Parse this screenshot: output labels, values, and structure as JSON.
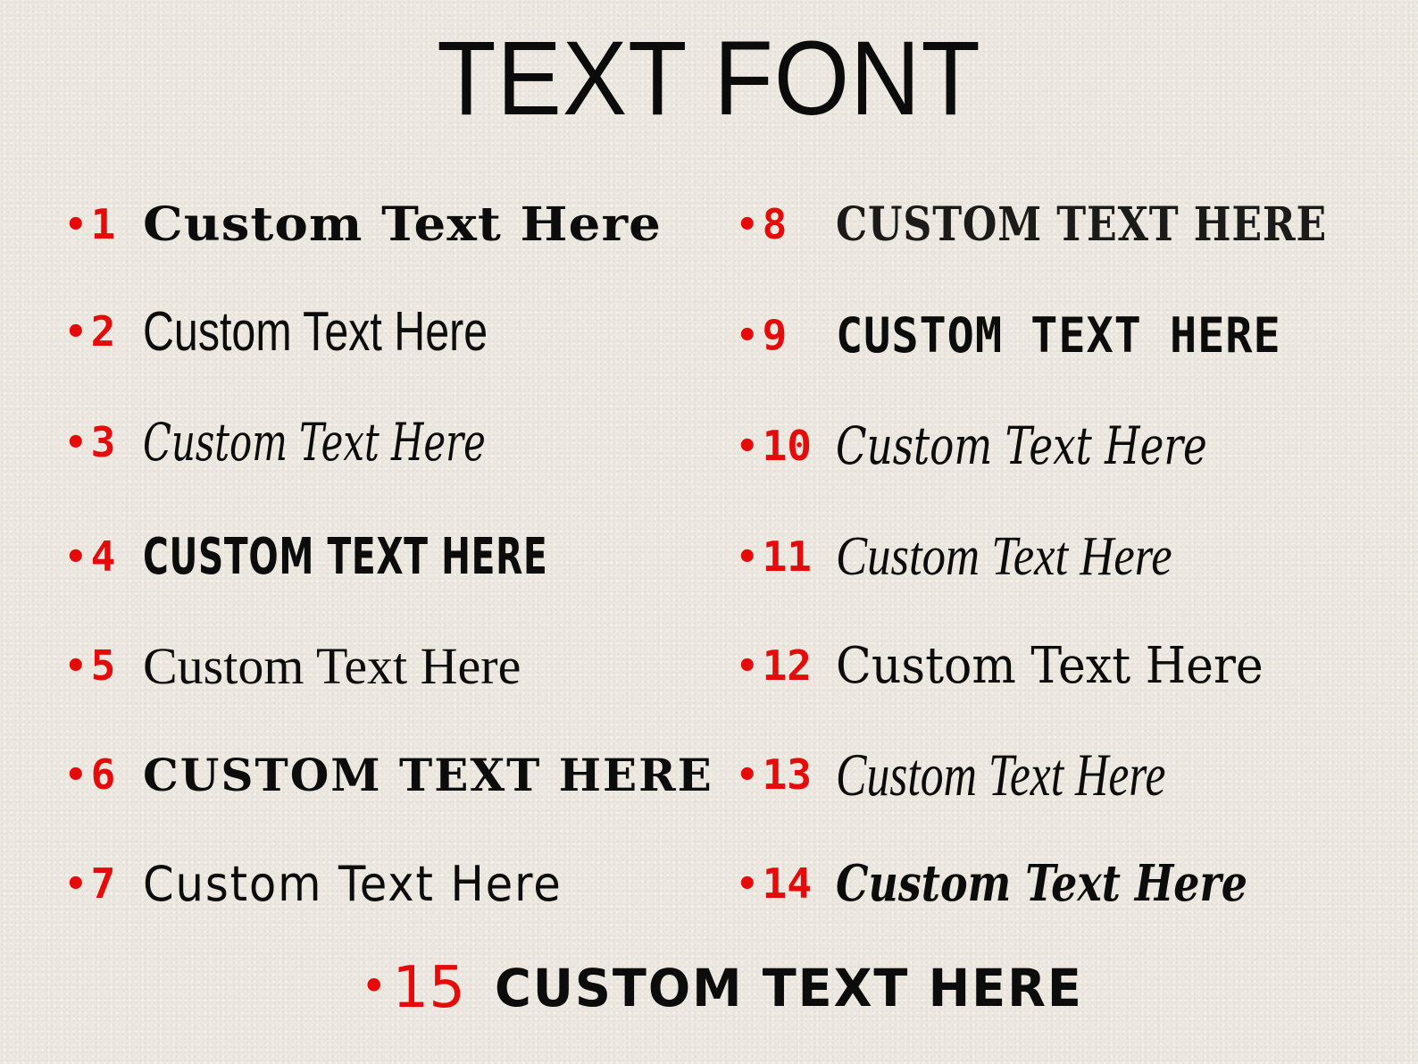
{
  "title": "TEXT FONT",
  "left_column": [
    {
      "number": "1",
      "text": "Custom Text Here"
    },
    {
      "number": "2",
      "text": "Custom Text Here"
    },
    {
      "number": "3",
      "text": "Custom Text Here"
    },
    {
      "number": "4",
      "text": "CUSTOM TEXT HERE"
    },
    {
      "number": "5",
      "text": "Custom Text Here"
    },
    {
      "number": "6",
      "text": "CUSTOM TEXT HERE"
    },
    {
      "number": "7",
      "text": "Custom Text Here"
    }
  ],
  "right_column": [
    {
      "number": "8",
      "text": "CUSTOM TEXT HERE"
    },
    {
      "number": "9",
      "text": "CUSTOM TEXT HERE"
    },
    {
      "number": "10",
      "text": "Custom Text Here"
    },
    {
      "number": "11",
      "text": "Custom Text Here"
    },
    {
      "number": "12",
      "text": "Custom Text Here"
    },
    {
      "number": "13",
      "text": "Custom Text Here"
    },
    {
      "number": "14",
      "text": "Custom Text Here"
    }
  ],
  "bottom_item": {
    "number": "15",
    "text": "CUSTOM TEXT HERE"
  },
  "colors": {
    "number": "#e50b0b",
    "text": "#0c0c0c",
    "background": "#ece7df"
  }
}
